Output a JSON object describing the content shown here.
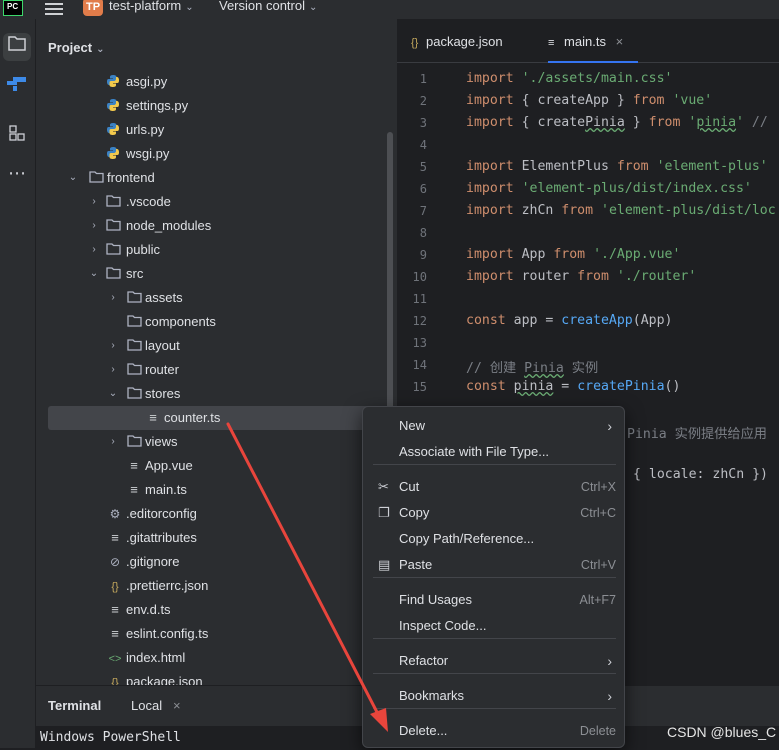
{
  "topbar": {
    "logo": "PC",
    "project_badge": "TP",
    "project_name": "test-platform",
    "vcs_label": "Version control"
  },
  "activity": [
    "folder-icon",
    "structure-icon",
    "plugins-icon",
    "more-icon"
  ],
  "project_panel": {
    "title": "Project",
    "tree": [
      {
        "label": "asgi.py",
        "icon": "python-file-icon"
      },
      {
        "label": "settings.py",
        "icon": "python-file-icon"
      },
      {
        "label": "urls.py",
        "icon": "python-file-icon"
      },
      {
        "label": "wsgi.py",
        "icon": "python-file-icon"
      },
      {
        "label": "frontend",
        "icon": "folder-icon",
        "expanded": true
      },
      {
        "label": ".vscode",
        "icon": "folder-icon"
      },
      {
        "label": "node_modules",
        "icon": "folder-icon"
      },
      {
        "label": "public",
        "icon": "folder-icon"
      },
      {
        "label": "src",
        "icon": "folder-icon",
        "expanded": true
      },
      {
        "label": "assets",
        "icon": "folder-icon"
      },
      {
        "label": "components",
        "icon": "folder-icon"
      },
      {
        "label": "layout",
        "icon": "folder-icon"
      },
      {
        "label": "router",
        "icon": "folder-icon"
      },
      {
        "label": "stores",
        "icon": "folder-icon",
        "expanded": true
      },
      {
        "label": "counter.ts",
        "icon": "ts-file-icon",
        "selected": true
      },
      {
        "label": "views",
        "icon": "folder-icon"
      },
      {
        "label": "App.vue",
        "icon": "vue-file-icon"
      },
      {
        "label": "main.ts",
        "icon": "ts-file-icon"
      },
      {
        "label": ".editorconfig",
        "icon": "gear-icon"
      },
      {
        "label": ".gitattributes",
        "icon": "lines-file-icon"
      },
      {
        "label": ".gitignore",
        "icon": "ignore-file-icon"
      },
      {
        "label": ".prettierrc.json",
        "icon": "json-file-icon"
      },
      {
        "label": "env.d.ts",
        "icon": "ts-file-icon"
      },
      {
        "label": "eslint.config.ts",
        "icon": "ts-file-icon"
      },
      {
        "label": "index.html",
        "icon": "html-file-icon"
      },
      {
        "label": "package.json",
        "icon": "json-file-icon"
      }
    ]
  },
  "editor": {
    "tabs": [
      {
        "label": "package.json",
        "icon": "json-file-icon",
        "active": false
      },
      {
        "label": "main.ts",
        "icon": "ts-file-icon",
        "active": true
      }
    ],
    "line_numbers": [
      "1",
      "2",
      "3",
      "4",
      "5",
      "6",
      "7",
      "8",
      "9",
      "10",
      "11",
      "12",
      "13",
      "14",
      "15"
    ],
    "visible_tail": {
      "comment": "Pinia 实例提供给应用",
      "use_line": "{ locale: zhCn })"
    }
  },
  "context_menu": {
    "items": [
      {
        "label": "New",
        "submenu": true
      },
      {
        "label": "Associate with File Type..."
      },
      {
        "label": "Cut",
        "shortcut": "Ctrl+X",
        "icon": "scissors-icon"
      },
      {
        "label": "Copy",
        "shortcut": "Ctrl+C",
        "icon": "copy-icon"
      },
      {
        "label": "Copy Path/Reference..."
      },
      {
        "label": "Paste",
        "shortcut": "Ctrl+V",
        "icon": "paste-icon"
      },
      {
        "label": "Find Usages",
        "shortcut": "Alt+F7"
      },
      {
        "label": "Inspect Code..."
      },
      {
        "label": "Refactor",
        "submenu": true
      },
      {
        "label": "Bookmarks",
        "submenu": true
      },
      {
        "label": "Delete...",
        "shortcut": "Delete"
      }
    ]
  },
  "terminal": {
    "title": "Terminal",
    "tab": "Local",
    "output": "Windows PowerShell"
  },
  "watermark": "CSDN @blues_C",
  "colors": {
    "accent": "#3574f0",
    "annotation_arrow": "#e8453c",
    "panel_bg": "#2b2d30",
    "editor_bg": "#1e1f22"
  }
}
